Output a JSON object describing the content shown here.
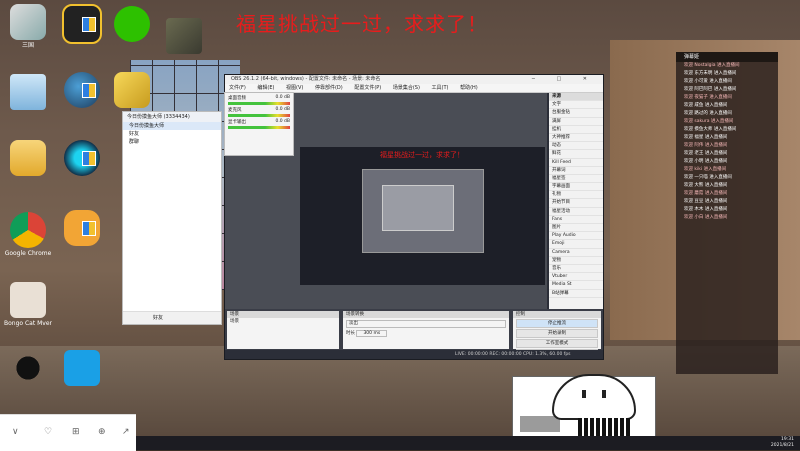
{
  "banner": "福星挑战过一过，求求了！",
  "preview_caption": "福星挑战过一过，求求了！",
  "desktop": {
    "icons": [
      {
        "label": "三国",
        "name": "app-icon"
      },
      {
        "label": "",
        "name": "qq-cloud-icon"
      },
      {
        "label": "",
        "name": "wechat-icon"
      },
      {
        "label": "",
        "name": "pubg-icon"
      },
      {
        "label": "",
        "name": "recycle-bin-icon"
      },
      {
        "label": "",
        "name": "steam-icon"
      },
      {
        "label": "",
        "name": "shortcut-icon"
      },
      {
        "label": "",
        "name": "folder-icon"
      },
      {
        "label": "",
        "name": "ooka-icon"
      },
      {
        "label": "Google Chrome",
        "name": "chrome-icon"
      },
      {
        "label": "",
        "name": "raccoon-icon"
      },
      {
        "label": "Bongo Cat Mver",
        "name": "bongo-cat-icon"
      },
      {
        "label": "",
        "name": "qq-penguin-icon"
      },
      {
        "label": "",
        "name": "ip-app-icon"
      }
    ]
  },
  "obs": {
    "title": "OBS 26.1.2 (64-bit, windows) - 配置文件: 未命名 - 场景: 未命名",
    "window_controls": "─ □ ✕",
    "menu": [
      "文件(F)",
      "编辑(E)",
      "视图(V)",
      "停靠部件(D)",
      "配置文件(P)",
      "场景集合(S)",
      "工具(T)",
      "帮助(H)"
    ],
    "sources_header": "来源",
    "sources": [
      "文字",
      "台服金钻",
      "满屏",
      "挂机",
      "大神推荐",
      "动态",
      "鲜花",
      "Kill Feed",
      "开幕词",
      "福星签",
      "字幕画面",
      "礼物",
      "开始节目",
      "福星活动",
      "Fans",
      "图片",
      "Play Audio",
      "Emoji",
      "Camera",
      "宠物",
      "音乐",
      "Vtuber",
      "Media St",
      "B站弹幕"
    ],
    "scenes_header": "场景",
    "scenes": [
      "场景"
    ],
    "mixer_header": "混音器",
    "mixer_rows": [
      {
        "label": "桌面音频",
        "db": "0.0 dB"
      },
      {
        "label": "麦克风",
        "db": "0.0 dB"
      },
      {
        "label": "显卡输出",
        "db": "0.0 dB"
      }
    ],
    "transition_header": "场景转换",
    "transition_value": "淡出",
    "transition_duration_label": "时长",
    "transition_duration": "300 ms",
    "controls_header": "控制",
    "controls": [
      "停止推流",
      "开始录制",
      "工作室模式",
      "设置",
      "退出"
    ],
    "status": "LIVE: 00:00:00   REC: 00:00:00   CPU: 1.3%, 60.00 fps"
  },
  "chat_window": {
    "title": "今日份摸鱼大师",
    "count": "(3334434)",
    "entries": [
      "今日份摸鱼大师",
      "好友",
      "群聊"
    ],
    "footer": "好友"
  },
  "danmaku": {
    "title": "弹幕姬",
    "lines": [
      "欢迎 Nostalgia 进入直播间",
      "欢迎 东方未明 进入直播间",
      "欢迎 小可爱 进入直播间",
      "欢迎 阿巴阿巴 进入直播间",
      "欢迎 夜猫子 进入直播间",
      "欢迎 咸鱼 进入直播间",
      "欢迎 路过的 进入直播间",
      "欢迎 sakura 进入直播间",
      "欢迎 摸鱼大师 进入直播间",
      "欢迎 福星 进入直播间",
      "欢迎 阿伟 进入直播间",
      "欢迎 老王 进入直播间",
      "欢迎 小明 进入直播间",
      "欢迎 kiki 进入直播间",
      "欢迎 一只喵 进入直播间",
      "欢迎 大熊 进入直播间",
      "欢迎 蘑菇 进入直播间",
      "欢迎 豆豆 进入直播间",
      "欢迎 木木 进入直播间",
      "欢迎 小白 进入直播间"
    ]
  },
  "phonebar": {
    "back": "∨",
    "like": "♡",
    "gift": "⊞",
    "follow": "⊕",
    "share": "↗"
  },
  "taskbar": {
    "time": "19:31",
    "date": "2021/8/21"
  },
  "colors": {
    "banner": "#e81c1c",
    "obs_bg": "#2b2e38"
  }
}
